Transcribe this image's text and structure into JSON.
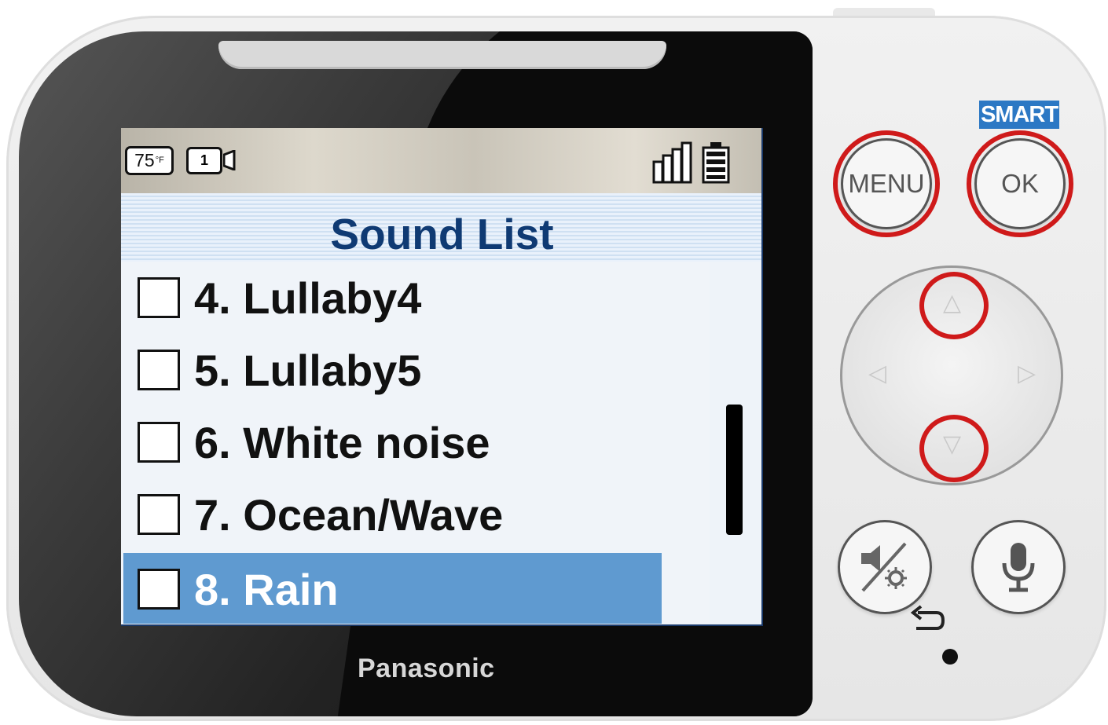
{
  "device": {
    "brand": "Panasonic"
  },
  "status_bar": {
    "temperature": "75",
    "temperature_unit_glyph": "°F",
    "camera_number": "1",
    "icons": [
      "thermometer-badge",
      "camera-icon",
      "signal-strength-icon",
      "battery-icon"
    ]
  },
  "screen": {
    "title": "Sound List",
    "items": [
      {
        "label": "4. Lullaby4",
        "checked": false,
        "selected": false
      },
      {
        "label": "5. Lullaby5",
        "checked": false,
        "selected": false
      },
      {
        "label": "6. White noise",
        "checked": false,
        "selected": false
      },
      {
        "label": "7. Ocean/Wave",
        "checked": false,
        "selected": false
      },
      {
        "label": "8. Rain",
        "checked": false,
        "selected": true
      }
    ],
    "colors": {
      "title": "#0f3a73",
      "selected_row": "#5f9ad0",
      "highlight_ring": "#cf1a1a"
    }
  },
  "buttons": {
    "smart_label": "SMART",
    "menu_label": "MENU",
    "ok_label": "OK"
  }
}
